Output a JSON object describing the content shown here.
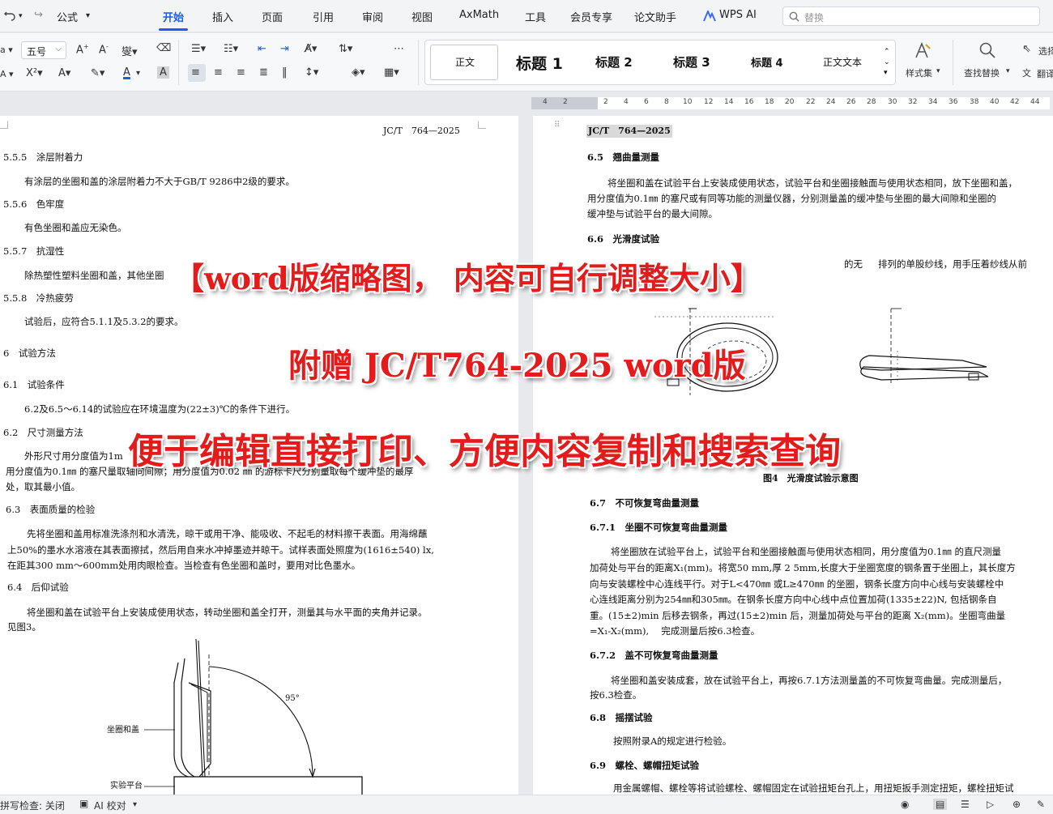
{
  "menubar": {
    "formula": "公式",
    "tabs": [
      "开始",
      "插入",
      "页面",
      "引用",
      "审阅",
      "视图",
      "AxMath",
      "工具",
      "会员专享",
      "论文助手",
      "WPS AI"
    ],
    "search_placeholder": "替换"
  },
  "ribbon": {
    "font_size": "五号",
    "styles": [
      "正文",
      "标题 1",
      "标题 2",
      "标题 3",
      "标题 4",
      "正文文本"
    ],
    "style_set": "样式集",
    "find_replace": "查找替换",
    "select": "选择",
    "translate": "翻译"
  },
  "ruler": {
    "ticks": [
      "4",
      "2",
      "2",
      "4",
      "6",
      "8",
      "10",
      "12",
      "14",
      "16",
      "18",
      "20",
      "22",
      "24",
      "26",
      "28",
      "30",
      "32",
      "34",
      "36",
      "38",
      "40",
      "42",
      "44"
    ]
  },
  "left_page": {
    "header": "JC/T　764—2025",
    "lines": [
      "5.5.5　涂层附着力",
      "有涂层的坐圈和盖的涂层附着力不大于GB/T 9286中2级的要求。",
      "5.5.6　色牢度",
      "有色坐圈和盖应无染色。",
      "5.5.7　抗湿性",
      "除热塑性塑料坐圈和盖，其他坐圈",
      "5.5.8　冷热疲劳",
      "试验后，应符合5.1.1及5.3.2的要求。",
      "6　试验方法",
      "6.1　试验条件",
      "6.2及6.5～6.14的试验应在环境温度为(22±3)℃的条件下进行。",
      "6.2　尺寸测量方法",
      "外形尺寸用分度值为1m",
      "用分度值为0.1㎜ 的塞尺量取轴向间隙；用分度值为0.02 ㎜ 的游标卡尺分别量取每个缓冲垫的最厚",
      "处，取其最小值。",
      "6.3　表面质量的检验",
      "先将坐圈和盖用标准洗涤剂和水清洗，晾干或用干净、能吸收、不起毛的材料擦干表面。用海绵蘸",
      "上50%的墨水水溶液在其表面擦拭，然后用自来水冲掉墨迹并晾干。试样表面处照度为(1616±540) lx,",
      "在距其300 mm～600mm处用肉眼检查。当检查有色坐圈和盖时，要用对比色墨水。",
      "6.4　后仰试验",
      "将坐圈和盖在试验平台上安装成使用状态，转动坐圈和盖全打开，测量其与水平面的夹角并记录。",
      "见图3。"
    ],
    "figure_labels": {
      "seat": "坐圈和盖",
      "platform": "实验平台",
      "angle": "95°"
    }
  },
  "right_page": {
    "header": "JC/T　764—2025",
    "lines": [
      "6.5　翘曲量测量",
      "将坐圈和盖在试验平台上安装成使用状态，试验平台和坐圈接触面与使用状态相同，放下坐圈和盖，",
      "用分度值为0.1㎜ 的塞尺或有同等功能的测量仪器，分别测量盖的缓冲垫与坐圈的最大间隙和坐圈的",
      "缓冲垫与试验平台的最大间隙。",
      "6.6　光滑度试验",
      "的无",
      "排列的单股纱线，用手压着纱线从前",
      "6.7　不可恢复弯曲量测量",
      "6.7.1　坐圈不可恢复弯曲量测量",
      "将坐圈放在试验平台上，试验平台和坐圈接触面与使用状态相同，用分度值为0.1㎜ 的直尺测量",
      "加荷处与平台的距离X₁(mm)。将宽50 mm,厚 2 5mm,长度大于坐圈宽度的钢条置于坐圈上，其长度方",
      "向与安装螺栓中心连线平行。对于L<470㎜ 或L≥470㎜ 的坐圈，钢条长度方向中心线与安装螺栓中",
      "心连线距离分别为254㎜和305㎜。在钢条长度方向中心线中点位置加荷(1335±22)N, 包括钢条自",
      "重。(15±2)min 后移去钢条，再过(15±2)min 后，测量加荷处与平台的距离 X₂(mm)。坐圈弯曲量",
      "=X₁-X₂(mm),　 完成测量后按6.3检查。",
      "6.7.2　盖不可恢复弯曲量测量",
      "将坐圈和盖安装成套，放在试验平台上，再按6.7.1方法测量盖的不可恢复弯曲量。完成测量后，",
      "按6.3检查。",
      "6.8　摇摆试验",
      "按照附录A的规定进行检验。",
      "6.9　螺栓、螺帽扭矩试验",
      "用金属螺帽、螺栓等将试验螺栓、螺帽固定在试验扭矩台孔上，用扭矩扳手测定扭矩，螺栓扭矩试"
    ],
    "figure_caption": "图4　光滑度试验示意图"
  },
  "overlay": {
    "line1": "【word版缩略图， 内容可自行调整大小】",
    "line2": "附赠 JC/T764-2025  word版",
    "line3": "便于编辑直接打印、方便内容复制和搜索查询"
  },
  "statusbar": {
    "spell_check": "拼写检查: 关闭",
    "ai_check": "AI 校对"
  },
  "colors": {
    "accent": "#1a5cf0",
    "overlay_red": "#e51b1b"
  }
}
